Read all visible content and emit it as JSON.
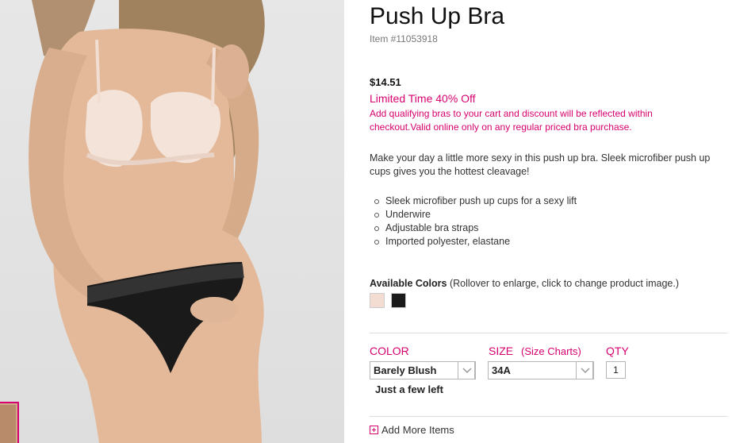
{
  "product": {
    "title": "Push Up Bra",
    "item_number": "Item #11053918",
    "price": "$14.51",
    "promo_headline": "Limited Time 40% Off",
    "promo_detail": "Add qualifying bras to your cart and discount will be reflected within checkout.Valid online only on any regular priced bra purchase.",
    "description": "Make your day a little more sexy in this push up bra. Sleek microfiber push up cups gives you the hottest cleavage!",
    "features": [
      "Sleek microfiber push up cups for a sexy lift",
      "Underwire",
      "Adjustable bra straps",
      "Imported polyester, elastane"
    ]
  },
  "colors": {
    "heading": "Available Colors",
    "hint": "(Rollover to enlarge, click to change product image.)",
    "swatches": [
      {
        "name": "blush-swatch",
        "color": "#f3dcd2"
      },
      {
        "name": "black-swatch",
        "color": "#1a1a1a"
      }
    ]
  },
  "options": {
    "color_label": "COLOR",
    "color_value": "Barely Blush",
    "size_label": "SIZE",
    "size_chart_link": "(Size Charts)",
    "size_value": "34A",
    "qty_label": "QTY",
    "qty_value": "1",
    "stock_status": "Just a few left"
  },
  "add_more": "Add More Items",
  "theme": {
    "accent": "#d6006f"
  }
}
